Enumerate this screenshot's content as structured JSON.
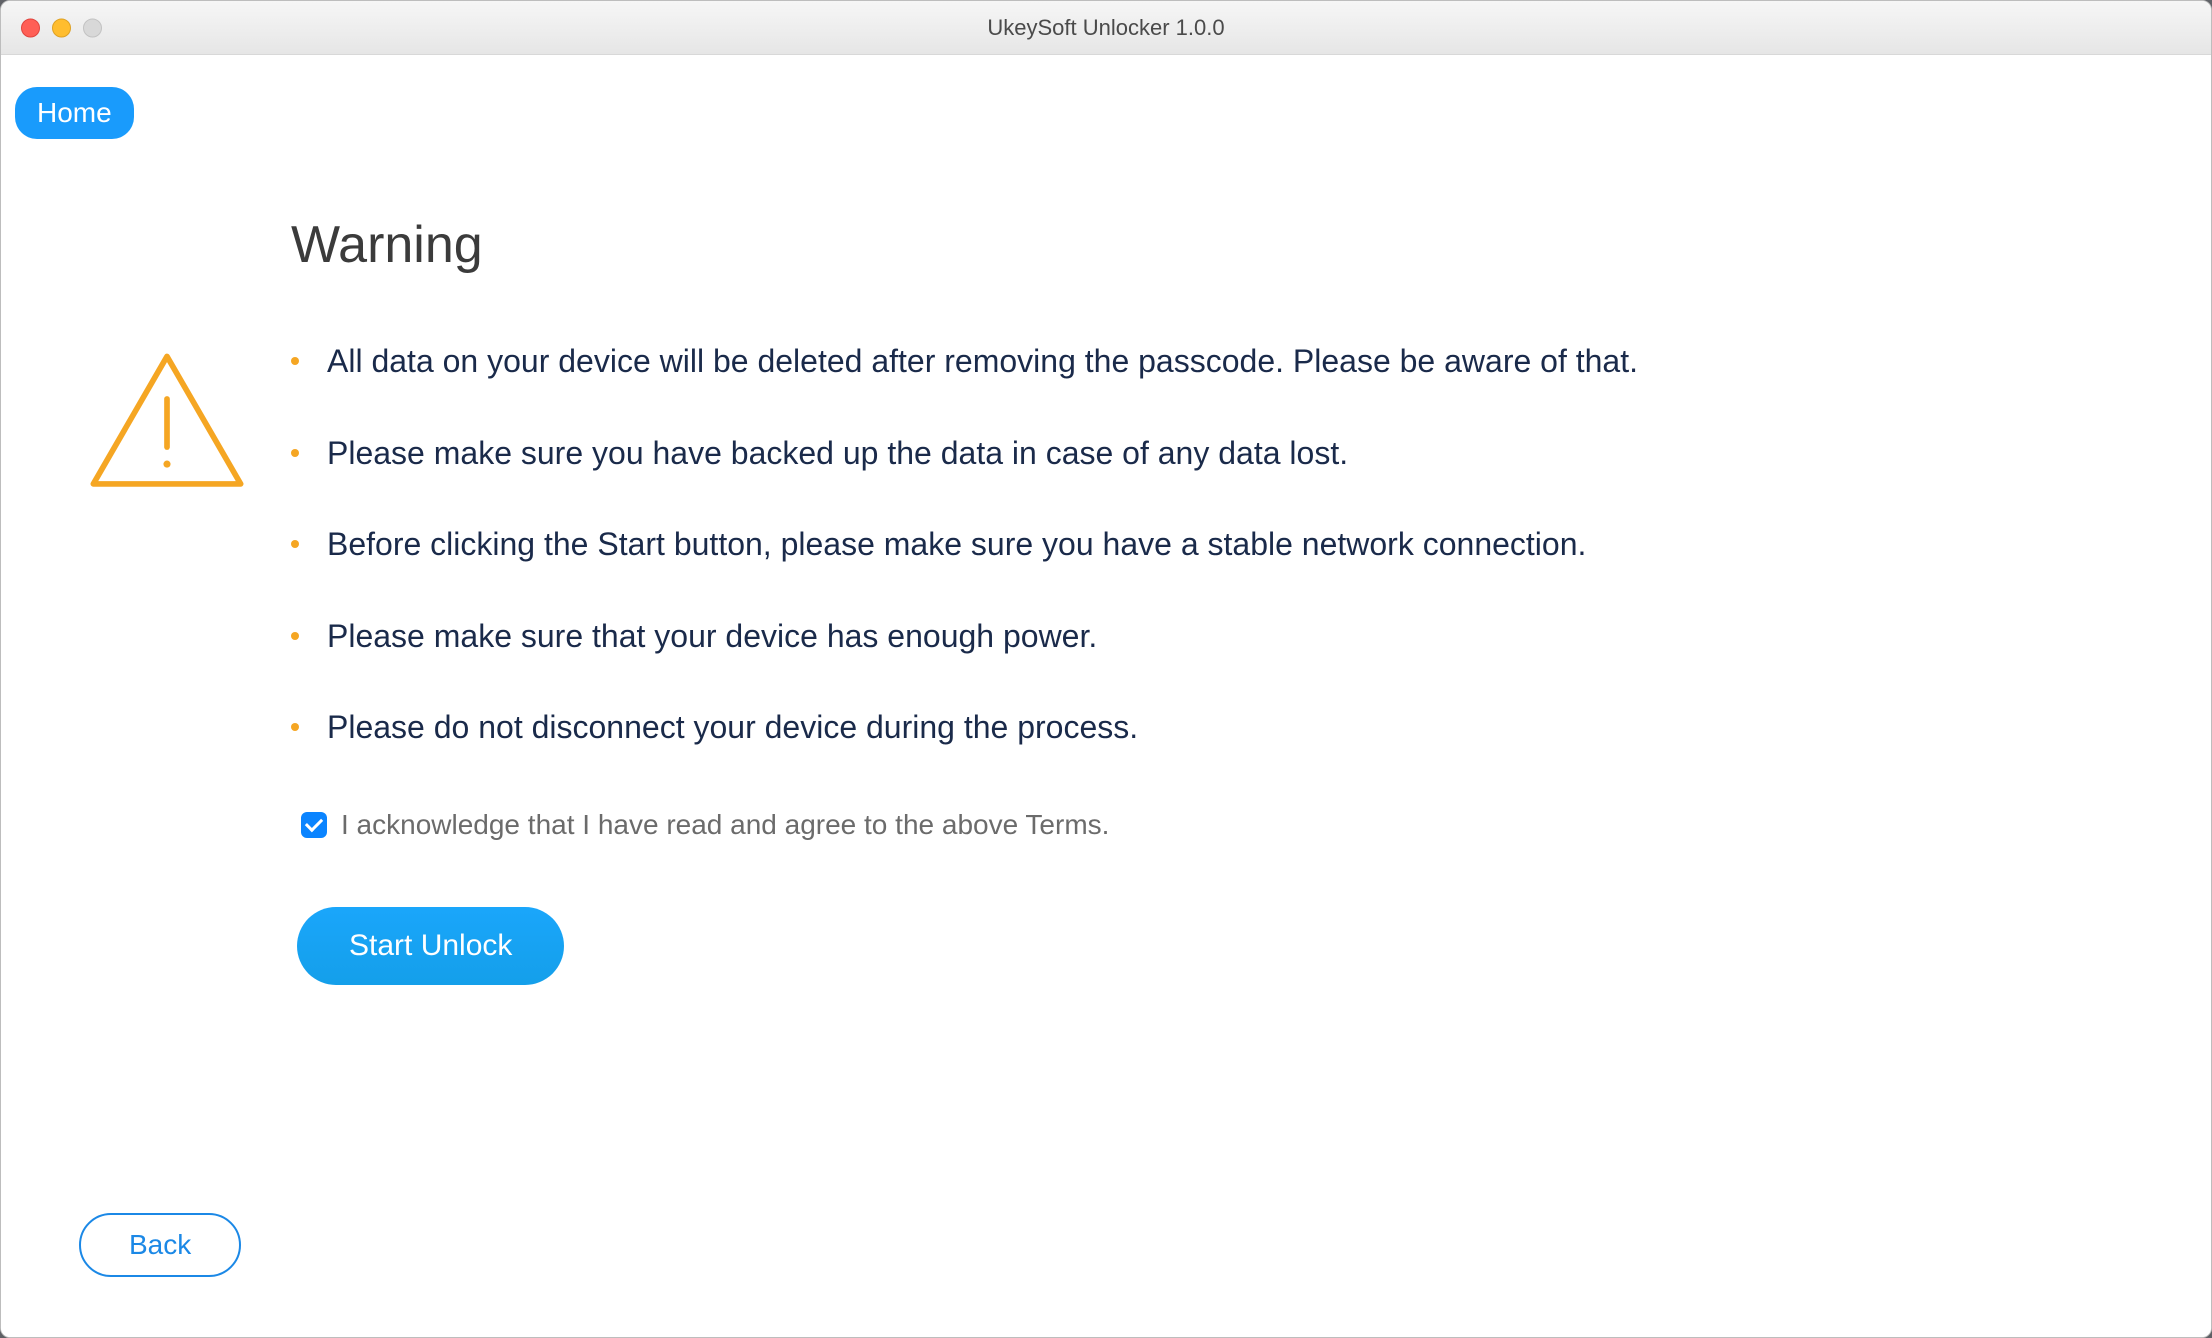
{
  "window": {
    "title": "UkeySoft Unlocker 1.0.0"
  },
  "nav": {
    "home_label": "Home"
  },
  "icon": {
    "name": "warning-triangle"
  },
  "page": {
    "heading": "Warning",
    "list_items": [
      "All data on your device will be deleted after removing the passcode. Please be aware of that.",
      "Please make sure you have backed up the data in case of any data lost.",
      "Before clicking the Start button, please make sure you have a stable network connection.",
      "Please make sure that your device has enough power.",
      "Please do not disconnect your device during the process."
    ],
    "ack_label": "I acknowledge that I have read and agree to the above Terms.",
    "ack_checked": true
  },
  "actions": {
    "start_label": "Start Unlock",
    "back_label": "Back"
  },
  "colors": {
    "accent": "#199bfc",
    "bullet": "#f5a623",
    "text_dark": "#1a2a4a"
  }
}
